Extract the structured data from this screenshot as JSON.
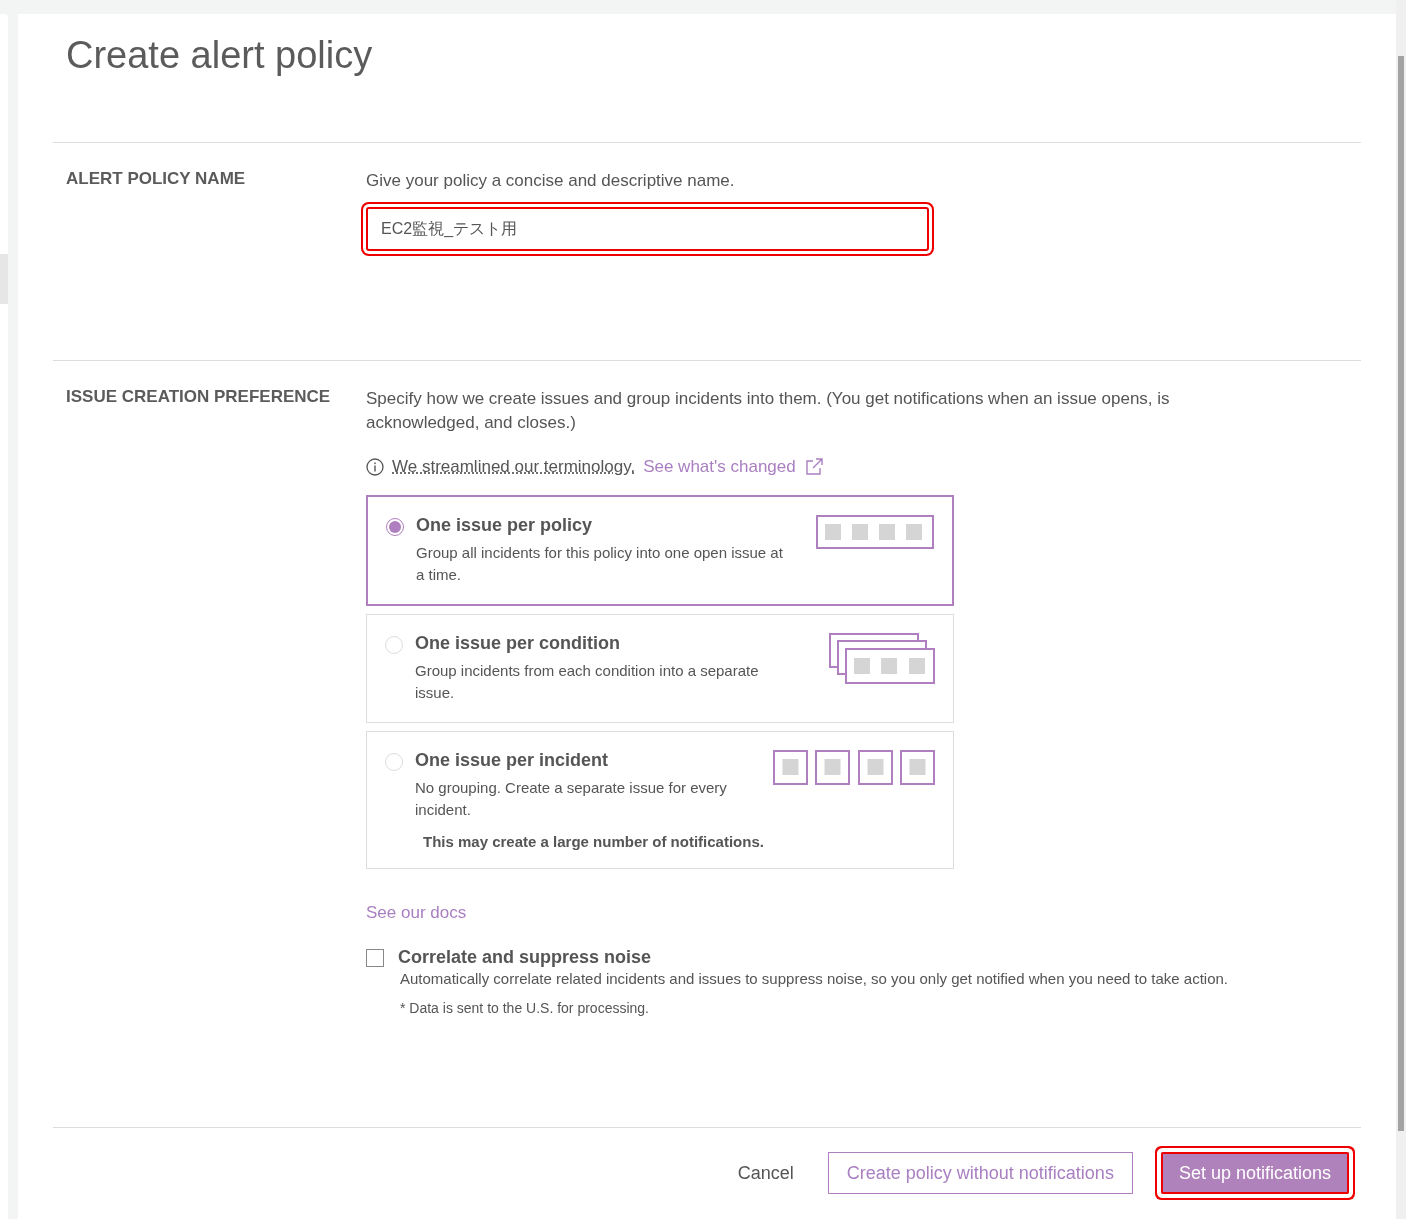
{
  "title": "Create alert policy",
  "name_section": {
    "label": "ALERT POLICY NAME",
    "hint": "Give your policy a concise and descriptive name.",
    "field": {
      "value": "EC2監視_テスト用",
      "highlighted": true
    }
  },
  "issue_section": {
    "label": "ISSUE CREATION PREFERENCE",
    "description": "Specify how we create issues and group incidents into them. (You get notifications when an issue opens, is acknowledged, and closes.)",
    "notice": "We streamlined our terminology.",
    "notice_link": "See what's changed",
    "options": [
      {
        "title": "One issue per policy",
        "description": "Group all incidents for this policy into one open issue at a time.",
        "selected": true,
        "kind": "single"
      },
      {
        "title": "One issue per condition",
        "description": "Group incidents from each condition into a separate issue.",
        "selected": false,
        "kind": "stacked"
      },
      {
        "title": "One issue per incident",
        "description": "No grouping. Create a separate issue for every incident.",
        "selected": false,
        "kind": "separate",
        "warning": "This may create a large number of notifications."
      }
    ],
    "docs_link": "See our docs",
    "correlate": {
      "label": "Correlate and suppress noise",
      "checked": false,
      "description": "Automatically correlate related incidents and issues to suppress noise, so you only get notified when you need to take action.",
      "note": "* Data is sent to the U.S. for processing."
    }
  },
  "footer": {
    "cancel": "Cancel",
    "secondary": "Create policy without notifications",
    "primary": {
      "label": "Set up notifications",
      "highlighted": true
    }
  }
}
